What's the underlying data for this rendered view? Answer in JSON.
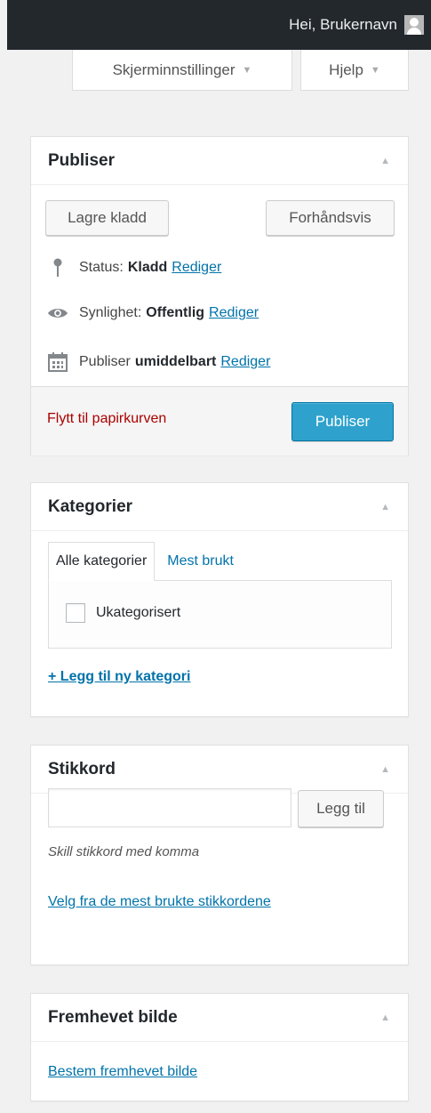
{
  "admin_bar": {
    "greeting": "Hei, Brukernavn"
  },
  "screen_meta": {
    "screen_options": "Skjerminnstillinger",
    "help": "Hjelp",
    "arrow": "▼"
  },
  "publish_box": {
    "title": "Publiser",
    "toggle": "▲",
    "save_draft": "Lagre kladd",
    "preview": "Forhåndsvis",
    "status": {
      "label": "Status:",
      "value": "Kladd",
      "edit": "Rediger"
    },
    "visibility": {
      "label": "Synlighet:",
      "value": "Offentlig",
      "edit": "Rediger"
    },
    "schedule": {
      "label": "Publiser",
      "value": "umiddelbart",
      "edit": "Rediger"
    },
    "trash": "Flytt til papirkurven",
    "publish": "Publiser"
  },
  "categories_box": {
    "title": "Kategorier",
    "toggle": "▲",
    "tab_all": "Alle kategorier",
    "tab_popular": "Mest brukt",
    "items": [
      {
        "label": "Ukategorisert",
        "checked": false
      }
    ],
    "add_new": "+ Legg til ny kategori"
  },
  "tags_box": {
    "title": "Stikkord",
    "toggle": "▲",
    "input_value": "",
    "add_button": "Legg til",
    "hint": "Skill stikkord med komma",
    "choose_popular": "Velg fra de mest brukte stikkordene"
  },
  "featured_box": {
    "title": "Fremhevet bilde",
    "toggle": "▲",
    "set_link": "Bestem fremhevet bilde"
  },
  "colors": {
    "admin_bar": "#23282d",
    "link": "#0073aa",
    "primary_button": "#2ea2cc",
    "trash": "#a00"
  }
}
